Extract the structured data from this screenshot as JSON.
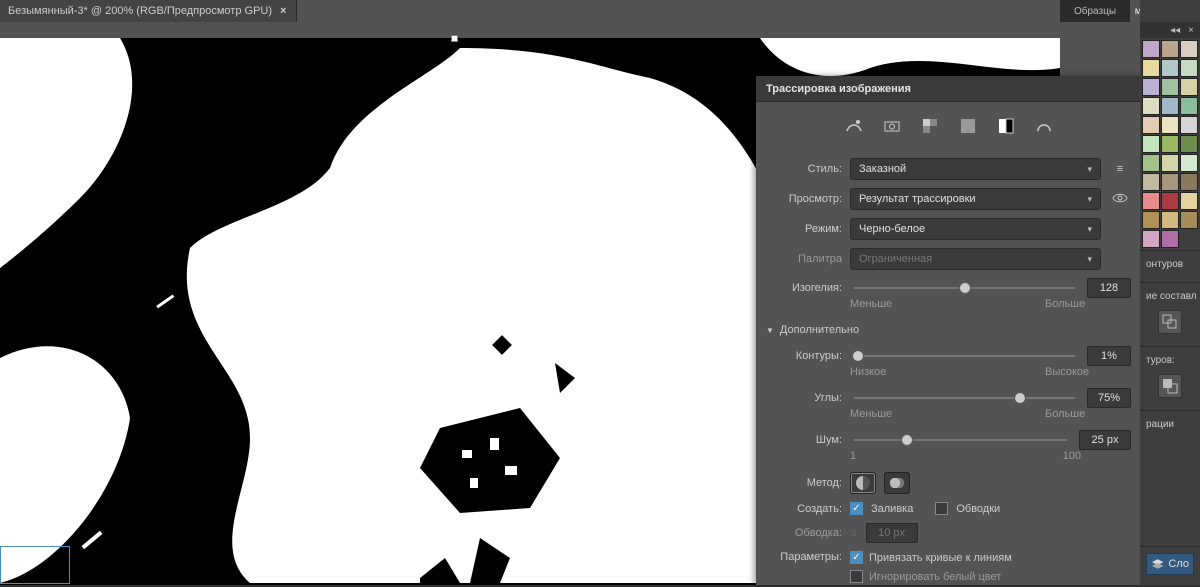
{
  "tab": {
    "title": "Безымянный-3* @ 200% (RGB/Предпросмотр GPU)"
  },
  "trace": {
    "title": "Трассировка изображения",
    "preset_icons": [
      "auto-color",
      "photo",
      "shades",
      "greys",
      "bw",
      "outline"
    ],
    "style_label": "Стиль:",
    "style_value": "Заказной",
    "view_label": "Просмотр:",
    "view_value": "Результат трассировки",
    "mode_label": "Режим:",
    "mode_value": "Черно-белое",
    "palette_label": "Палитра",
    "palette_value": "Ограниченная",
    "threshold_label": "Изогелия:",
    "threshold_value": "128",
    "threshold_min": "Меньше",
    "threshold_max": "Больше",
    "advanced_label": "Дополнительно",
    "paths_label": "Контуры:",
    "paths_value": "1%",
    "paths_min": "Низкое",
    "paths_max": "Высокое",
    "corners_label": "Углы:",
    "corners_value": "75%",
    "corners_min": "Меньше",
    "corners_max": "Больше",
    "noise_label": "Шум:",
    "noise_value": "25 px",
    "noise_min": "1",
    "noise_max": "100",
    "method_label": "Метод:",
    "create_label": "Создать:",
    "create_fills": "Заливка",
    "create_strokes": "Обводки",
    "stroke_label": "Обводка:",
    "stroke_value": "10 px",
    "options_label": "Параметры:",
    "snap_curves": "Привязать кривые к линиям",
    "ignore_white": "Игнорировать белый цвет"
  },
  "swatch_colors": [
    "#bfa6c9",
    "#b8a48f",
    "#d8cdbf",
    "#e8d9a0",
    "#b1c8c8",
    "#c6d9c2",
    "#bcb0d6",
    "#a3bfa1",
    "#d7d0a6",
    "#e0dcc3",
    "#a0b7c9",
    "#8bbf9b",
    "#e2cdb2",
    "#e9e3c2",
    "#d5d5d5",
    "#c1e4bc",
    "#9bb863",
    "#6e8f4b",
    "#a0c28a",
    "#d2d6a8",
    "#d4e8d0",
    "#c3b9a2",
    "#a6987d",
    "#8a7a5c",
    "#e88b8b",
    "#ad3b42",
    "#e3d2a0",
    "#b09057",
    "#d3b97f",
    "#a68c5a",
    "#d0a6c2",
    "#b06fa8"
  ],
  "dock": {
    "tab_a": "Образцы",
    "tab_b": "мои палитры",
    "paths_label": "онтуров",
    "align_label": "ие составл",
    "shape_label": "туров:",
    "graphics_label": "рации",
    "layers_btn": "Сло"
  }
}
